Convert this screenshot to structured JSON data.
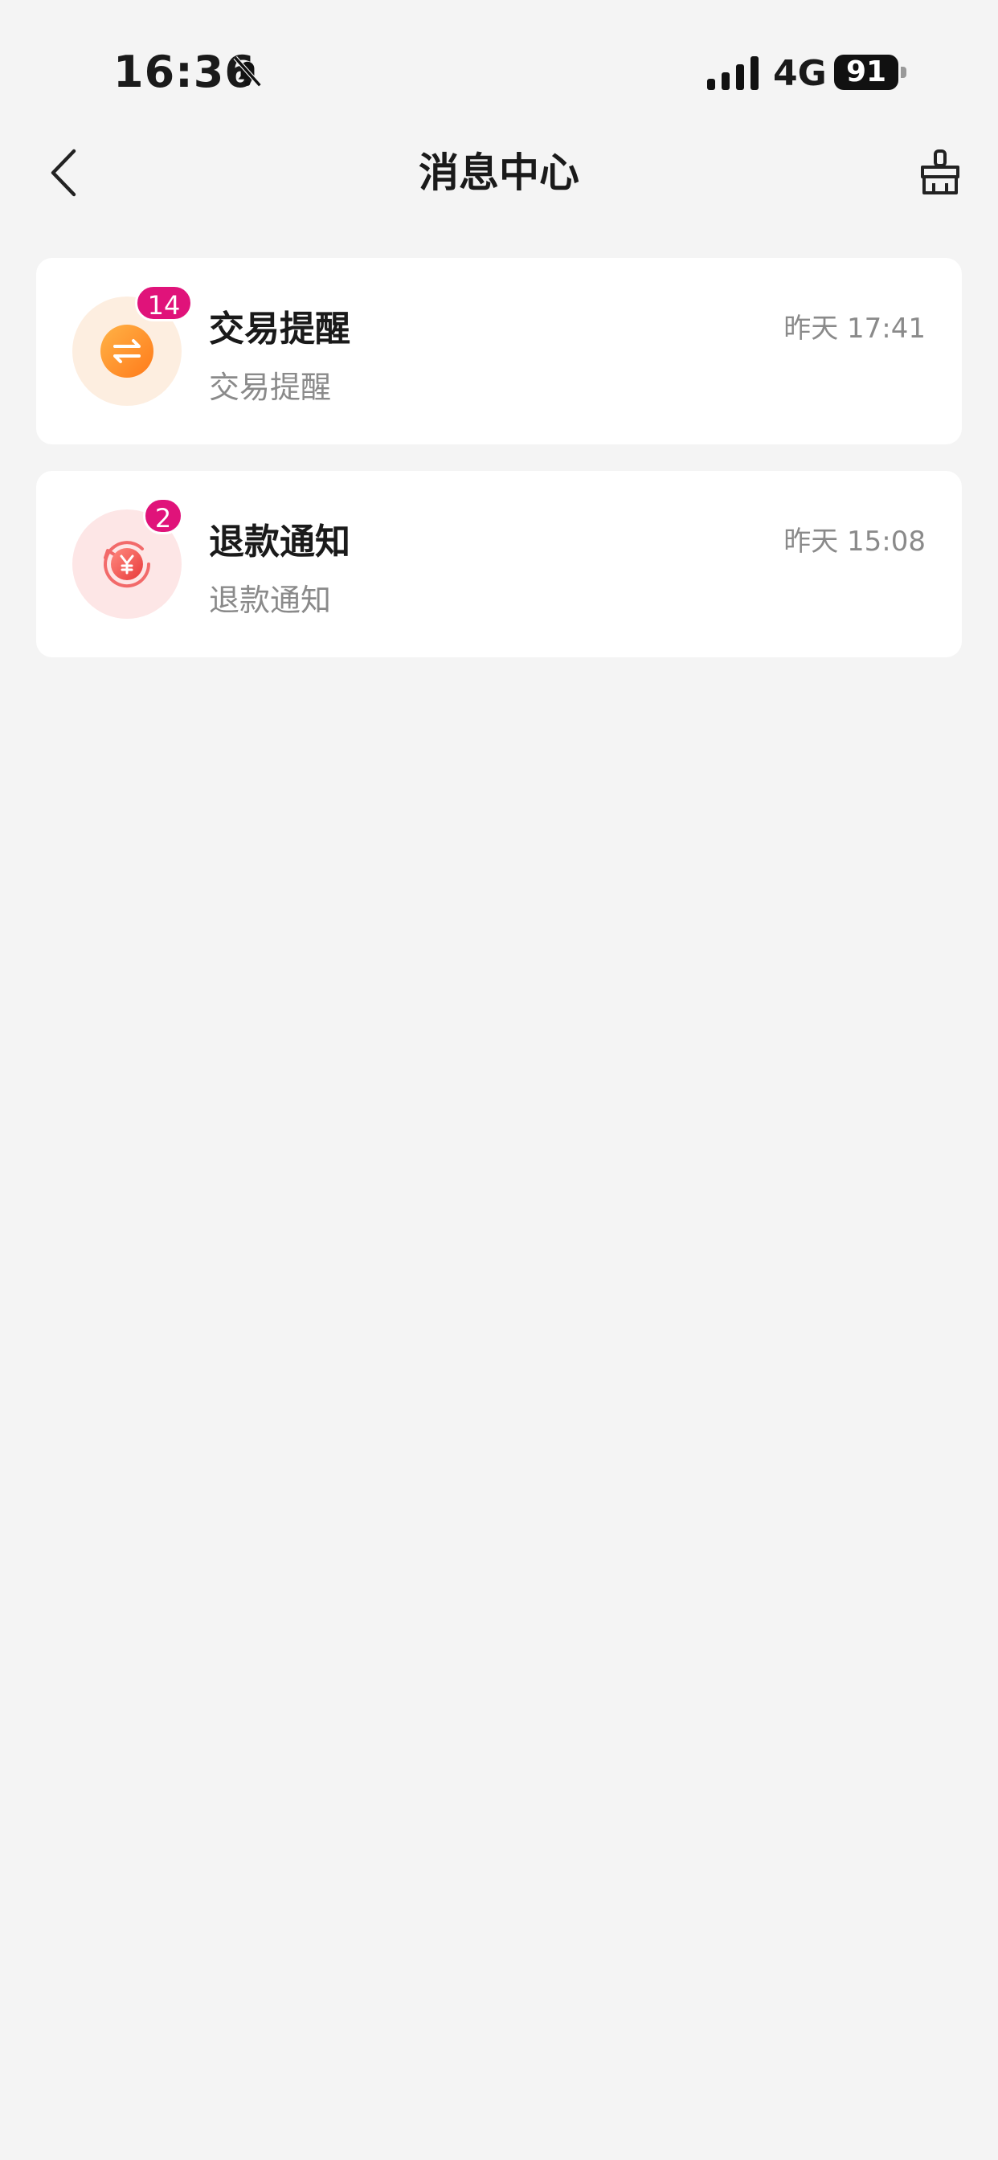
{
  "status_bar": {
    "time": "16:36",
    "network": "4G",
    "battery": "91",
    "icons": [
      "bell-muted-icon",
      "signal-icon",
      "battery-icon"
    ]
  },
  "nav": {
    "title": "消息中心",
    "back_icon": "chevron-left-icon",
    "clean_icon": "broom-icon"
  },
  "messages": [
    {
      "title": "交易提醒",
      "subtitle": "交易提醒",
      "time": "昨天 17:41",
      "badge": "14",
      "icon": "exchange-icon",
      "color": "#f7931e"
    },
    {
      "title": "退款通知",
      "subtitle": "退款通知",
      "time": "昨天 15:08",
      "badge": "2",
      "icon": "refund-yen-icon",
      "color": "#f04545"
    }
  ],
  "colors": {
    "background": "#f4f4f4",
    "badge": "#e0137a",
    "secondary_text": "#8a8a8a"
  }
}
